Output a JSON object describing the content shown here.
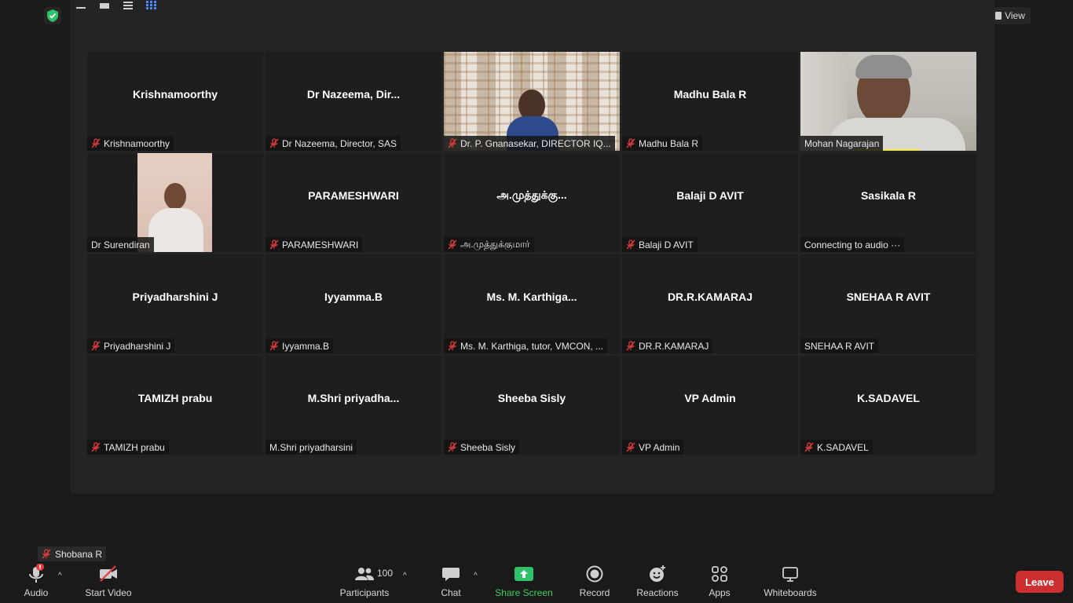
{
  "view_label": "View",
  "tiles": [
    {
      "center": "Krishnamoorthy",
      "label": "Krishnamoorthy",
      "muted": true
    },
    {
      "center": "Dr  Nazeema,  Dir...",
      "label": "Dr Nazeema, Director, SAS",
      "muted": true
    },
    {
      "center": "",
      "label": "Dr. P. Gnanasekar, DIRECTOR IQ...",
      "muted": true
    },
    {
      "center": "Madhu Bala R",
      "label": "Madhu Bala R",
      "muted": true
    },
    {
      "center": "",
      "label": "Mohan Nagarajan",
      "muted": false
    },
    {
      "center": "",
      "label": "Dr Surendiran",
      "muted": false
    },
    {
      "center": "PARAMESHWARI",
      "label": "PARAMESHWARI",
      "muted": true
    },
    {
      "center": "அ.முத்துக்கு...",
      "label": "அ.முத்துக்குமார்",
      "muted": true
    },
    {
      "center": "Balaji D AVIT",
      "label": "Balaji D AVIT",
      "muted": true
    },
    {
      "center": "Sasikala R",
      "label": "Connecting to audio ···",
      "muted": false
    },
    {
      "center": "Priyadharshini J",
      "label": "Priyadharshini J",
      "muted": true
    },
    {
      "center": "Iyyamma.B",
      "label": "Iyyamma.B",
      "muted": true
    },
    {
      "center": "Ms.  M.  Karthiga...",
      "label": "Ms. M. Karthiga, tutor, VMCON, ...",
      "muted": true
    },
    {
      "center": "DR.R.KAMARAJ",
      "label": "DR.R.KAMARAJ",
      "muted": true
    },
    {
      "center": "SNEHAA R AVIT",
      "label": "SNEHAA R AVIT",
      "muted": false
    },
    {
      "center": "TAMIZH prabu",
      "label": "TAMIZH prabu",
      "muted": true
    },
    {
      "center": "M.Shri  priyadha...",
      "label": "M.Shri priyadharsini",
      "muted": false
    },
    {
      "center": "Sheeba Sisly",
      "label": "Sheeba Sisly",
      "muted": true
    },
    {
      "center": "VP Admin",
      "label": "VP Admin",
      "muted": true
    },
    {
      "center": "K.SADAVEL",
      "label": "K.SADAVEL",
      "muted": true
    }
  ],
  "self_view": {
    "label": "Shobana R"
  },
  "toolbar": {
    "audio": "Audio",
    "start_video": "Start Video",
    "participants": "Participants",
    "participants_count": "100",
    "chat": "Chat",
    "share_screen": "Share Screen",
    "record": "Record",
    "reactions": "Reactions",
    "apps": "Apps",
    "whiteboards": "Whiteboards",
    "leave": "Leave"
  },
  "colors": {
    "background": "#1a1a1a",
    "tile": "#1e1e1e",
    "mute_red": "#e03c3c",
    "share_green": "#3fd05f",
    "leave_red": "#cc2f2f"
  }
}
